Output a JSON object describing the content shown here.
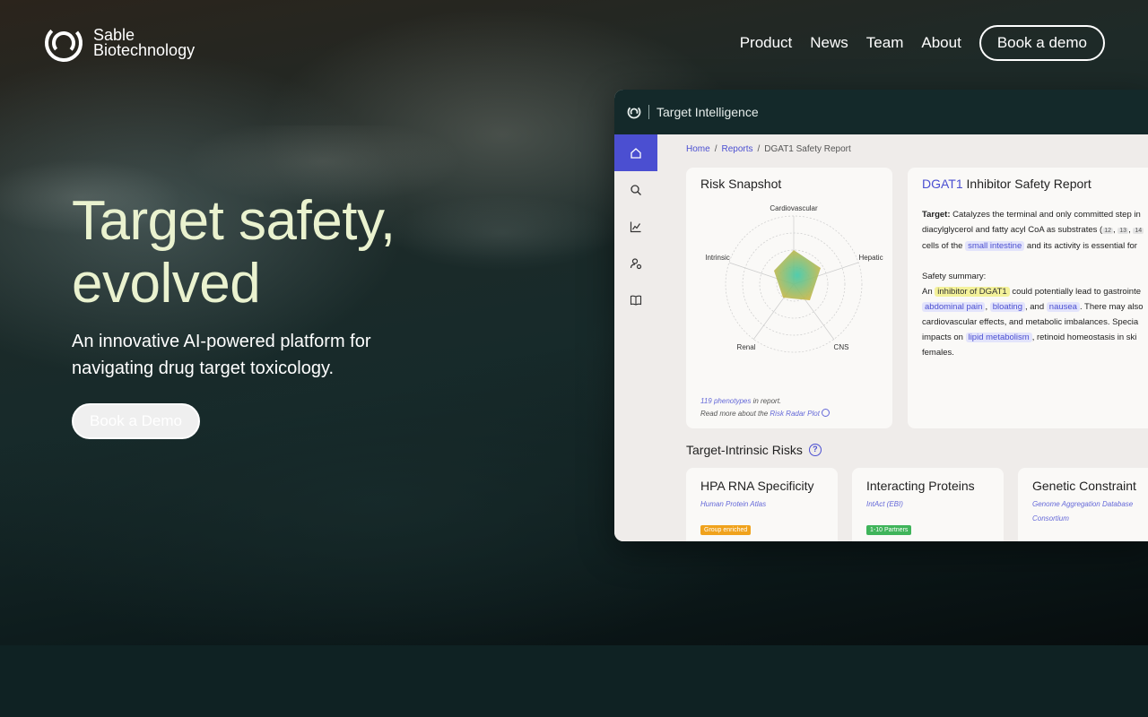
{
  "brand": {
    "line1": "Sable",
    "line2": "Biotechnology",
    "logo_icon": "sable-swirl-logo-icon"
  },
  "nav": {
    "items": [
      "Product",
      "News",
      "Team",
      "About"
    ],
    "cta": "Book a demo"
  },
  "hero": {
    "headline_line1": "Target safety,",
    "headline_line2": "evolved",
    "subhead_line1": "An innovative AI-powered platform for",
    "subhead_line2": "navigating drug target toxicology.",
    "cta": "Book a Demo"
  },
  "app": {
    "title": "Target Intelligence",
    "sidebar_icons": [
      "home-icon",
      "search-icon",
      "chart-line-icon",
      "user-settings-icon",
      "book-icon"
    ],
    "breadcrumb": {
      "home": "Home",
      "reports": "Reports",
      "current": "DGAT1 Safety Report",
      "sep": "/"
    },
    "risk_snapshot": {
      "title": "Risk Snapshot",
      "axes": [
        "Cardiovascular",
        "Hepatic",
        "CNS",
        "Renal",
        "Intrinsic"
      ],
      "footnote_link1": "119 phenotypes",
      "footnote_text1": " in report.",
      "footnote_text2": "Read more about the ",
      "footnote_link2": "Risk Radar Plot"
    },
    "report": {
      "title_gene": "DGAT1",
      "title_rest": " Inhibitor Safety Report",
      "target_label": "Target:",
      "target_line1": " Catalyzes the terminal and only committed step in",
      "target_line2a": "diacylglycerol and fatty acyl CoA as substrates (",
      "ref1": "12",
      "ref2": "13",
      "ref3": "14",
      "target_line3a": "cells of the ",
      "tag_small_intestine": "small intestine",
      "target_line3b": " and its activity is essential for",
      "summary_label": "Safety summary:",
      "sum_line1a": "An ",
      "tag_inhibitor": "inhibitor of DGAT1",
      "sum_line1b": " could potentially lead to gastrointe",
      "tag_abdominal": "abdominal pain",
      "tag_bloating": "bloating",
      "sum_and": ", and ",
      "tag_nausea": "nausea",
      "sum_line2b": ". There may also",
      "sum_line3": "cardiovascular effects, and metabolic imbalances. Specia",
      "sum_line4a": "impacts on ",
      "tag_lipid": "lipid metabolism",
      "sum_line4b": ", retinoid homeostasis in ski",
      "sum_line5": "females."
    },
    "intrinsic": {
      "title": "Target-Intrinsic Risks",
      "cards": [
        {
          "title": "HPA RNA Specificity",
          "source": "Human Protein Atlas",
          "badge": "Group enriched",
          "badge_color": "#f0a21c"
        },
        {
          "title": "Interacting Proteins",
          "source": "IntAct (EBI)",
          "badge": "1-10 Partners",
          "badge_color": "#3fb45a"
        },
        {
          "title": "Genetic Constraint",
          "source_line1": "Genome Aggregation Database",
          "source_line2": "Consortium"
        }
      ]
    }
  }
}
